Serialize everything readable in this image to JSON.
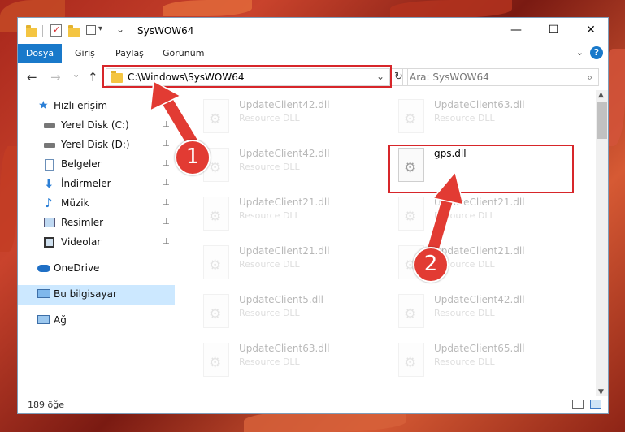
{
  "window": {
    "title": "SysWOW64",
    "minimize": "—",
    "maximize": "☐",
    "close": "✕"
  },
  "ribbon": {
    "tabs": [
      "Dosya",
      "Giriş",
      "Paylaş",
      "Görünüm"
    ],
    "expand": "⌄",
    "help": "?"
  },
  "navbar": {
    "back": "←",
    "forward": "→",
    "recent": "⌄",
    "up": "↑",
    "address": "C:\\Windows\\SysWOW64",
    "address_dropdown": "⌄",
    "refresh": "↻",
    "search_placeholder": "Ara: SysWOW64",
    "search_icon": "⌕"
  },
  "sidebar": {
    "items": [
      {
        "label": "Hızlı erişim",
        "icon": "star-icon"
      },
      {
        "label": "Yerel Disk (C:)",
        "icon": "drive-icon",
        "pinned": true
      },
      {
        "label": "Yerel Disk (D:)",
        "icon": "drive-icon",
        "pinned": true
      },
      {
        "label": "Belgeler",
        "icon": "documents-icon",
        "pinned": true
      },
      {
        "label": "İndirmeler",
        "icon": "download-icon",
        "pinned": true
      },
      {
        "label": "Müzik",
        "icon": "music-icon",
        "pinned": true
      },
      {
        "label": "Resimler",
        "icon": "pictures-icon",
        "pinned": true
      },
      {
        "label": "Videolar",
        "icon": "videos-icon",
        "pinned": true
      },
      {
        "label": "OneDrive",
        "icon": "cloud-icon"
      },
      {
        "label": "Bu bilgisayar",
        "icon": "computer-icon",
        "selected": true
      },
      {
        "label": "Ağ",
        "icon": "network-icon"
      }
    ],
    "pin_glyph": "📌"
  },
  "files": {
    "left": [
      {
        "name": "UpdateClient42.dll",
        "type": "Resource DLL"
      },
      {
        "name": "UpdateClient42.dll",
        "type": "Resource DLL"
      },
      {
        "name": "UpdateClient21.dll",
        "type": "Resource DLL"
      },
      {
        "name": "UpdateClient21.dll",
        "type": "Resource DLL"
      },
      {
        "name": "UpdateClient5.dll",
        "type": "Resource DLL"
      },
      {
        "name": "UpdateClient63.dll",
        "type": "Resource DLL"
      }
    ],
    "right": [
      {
        "name": "UpdateClient63.dll",
        "type": "Resource DLL"
      },
      {
        "name": "gps.dll",
        "type": ""
      },
      {
        "name": "UpdateClient21.dll",
        "type": "Resource DLL"
      },
      {
        "name": "UpdateClient21.dll",
        "type": "Resource DLL"
      },
      {
        "name": "UpdateClient42.dll",
        "type": "Resource DLL"
      },
      {
        "name": "UpdateClient65.dll",
        "type": "Resource DLL"
      }
    ]
  },
  "status": {
    "item_count": "189 öğe"
  },
  "annotations": {
    "step1": "1",
    "step2": "2",
    "highlight_color": "#d7262a"
  }
}
